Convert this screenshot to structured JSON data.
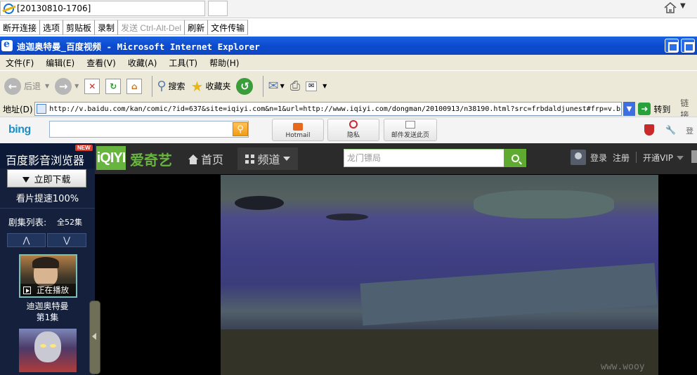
{
  "outer_window": {
    "tab_title": "[20130810-1706]"
  },
  "remote_menu": [
    "断开连接",
    "选项",
    "剪贴板",
    "录制",
    "发送 Ctrl-Alt-Del",
    "刷新",
    "文件传输"
  ],
  "ie": {
    "title": "迪迦奥特曼_百度视频 - Microsoft Internet Explorer",
    "menu": [
      "文件(F)",
      "编辑(E)",
      "查看(V)",
      "收藏(A)",
      "工具(T)",
      "帮助(H)"
    ],
    "toolbar": {
      "back": "后退",
      "search": "搜索",
      "favorites": "收藏夹"
    },
    "address": {
      "label": "地址(D)",
      "url": "http://v.baidu.com/kan/comic/?id=637&site=iqiyi.com&n=1&url=http://www.iqiyi.com/dongman/20100913/n38190.html?src=frbdaldjunest#frp=v.b",
      "go": "转到",
      "links": "链接"
    }
  },
  "bing_bar": {
    "logo": "bing",
    "tiles": {
      "hotmail": "Hotmail",
      "privacy": "隐私",
      "mail": "邮件发送此页"
    },
    "more": "登"
  },
  "sidebar": {
    "promo_title": "百度影音浏览器",
    "new_badge": "NEW",
    "download": "立即下载",
    "speed": "看片提速100%",
    "list_title": "剧集列表:",
    "list_count": "全52集",
    "up": "⋀",
    "down": "⋁",
    "episodes": [
      {
        "playing": "正在播放",
        "title": "迪迦奥特曼",
        "num": "第1集"
      }
    ]
  },
  "iqiyi": {
    "logo": "iQIYI",
    "logo_cn": "爱奇艺",
    "home": "首页",
    "channel": "频道",
    "search_placeholder": "龙门镖局",
    "login": "登录",
    "register": "注册",
    "vip": "开通VIP"
  },
  "watermark": "www.wooy"
}
